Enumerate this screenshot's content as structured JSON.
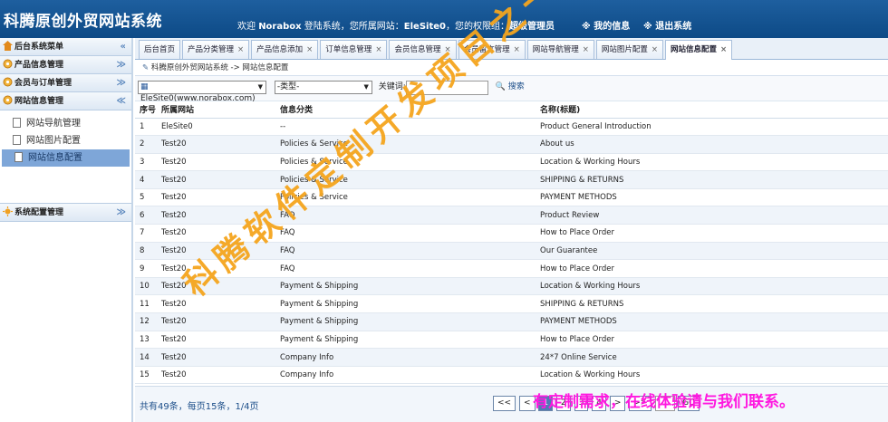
{
  "header": {
    "title": "科腾原创外贸网站系统",
    "welcome_prefix": "欢迎",
    "user": "Norabox",
    "welcome_mid": "登陆系统，您所属网站：",
    "site": "EleSite0",
    "role_prefix": "，您的权限组：",
    "role": "超级管理员",
    "my_info": "※ 我的信息",
    "logout": "※ 退出系统"
  },
  "sidebar": {
    "sections": [
      {
        "label": "后台系统菜单",
        "icon": "house-icon"
      },
      {
        "label": "产品信息管理",
        "icon": "gear-icon"
      },
      {
        "label": "会员与订单管理",
        "icon": "gear-icon"
      },
      {
        "label": "网站信息管理",
        "icon": "gear-icon"
      },
      {
        "label": "系统配置管理",
        "icon": "sun-icon"
      }
    ],
    "items": [
      "网站导航管理",
      "网站图片配置",
      "网站信息配置"
    ],
    "colors": {
      "accent": "#0d4a86",
      "active_item": "#7ea6d8"
    }
  },
  "tabs": [
    {
      "label": "后台首页",
      "closable": false
    },
    {
      "label": "产品分类管理",
      "closable": true
    },
    {
      "label": "产品信息添加",
      "closable": true
    },
    {
      "label": "订单信息管理",
      "closable": true
    },
    {
      "label": "会员信息管理",
      "closable": true
    },
    {
      "label": "会员留言管理",
      "closable": true
    },
    {
      "label": "网站导航管理",
      "closable": true
    },
    {
      "label": "网站图片配置",
      "closable": true
    },
    {
      "label": "网站信息配置",
      "closable": true,
      "active": true
    }
  ],
  "breadcrumb": "科腾原创外贸网站系统 -> 网站信息配置",
  "filters": {
    "site_select": "EleSite0(www.norabox.com)",
    "type_select": "-类型-",
    "keyword_label": "关键词:",
    "keyword_value": "",
    "search_label": "搜索"
  },
  "table": {
    "headers": [
      "序号",
      "所属网站",
      "信息分类",
      "名称(标题)"
    ],
    "rows": [
      [
        "1",
        "EleSite0",
        "--",
        "Product General Introduction"
      ],
      [
        "2",
        "Test20",
        "Policies & Service",
        "About us"
      ],
      [
        "3",
        "Test20",
        "Policies & Service",
        "Location & Working Hours"
      ],
      [
        "4",
        "Test20",
        "Policies & Service",
        "SHIPPING & RETURNS"
      ],
      [
        "5",
        "Test20",
        "Policies & Service",
        "PAYMENT METHODS"
      ],
      [
        "6",
        "Test20",
        "FAQ",
        "Product Review"
      ],
      [
        "7",
        "Test20",
        "FAQ",
        "How to Place Order"
      ],
      [
        "8",
        "Test20",
        "FAQ",
        "Our Guarantee"
      ],
      [
        "9",
        "Test20",
        "FAQ",
        "How to Place Order"
      ],
      [
        "10",
        "Test20",
        "Payment & Shipping",
        "Location & Working Hours"
      ],
      [
        "11",
        "Test20",
        "Payment & Shipping",
        "SHIPPING & RETURNS"
      ],
      [
        "12",
        "Test20",
        "Payment & Shipping",
        "PAYMENT METHODS"
      ],
      [
        "13",
        "Test20",
        "Payment & Shipping",
        "How to Place Order"
      ],
      [
        "14",
        "Test20",
        "Company Info",
        "24*7 Online Service"
      ],
      [
        "15",
        "Test20",
        "Company Info",
        "Location & Working Hours"
      ]
    ]
  },
  "footer": {
    "count_text": "共有49条，每页15条，1/4页",
    "pager": [
      "<<",
      "<",
      "1",
      "2",
      "3",
      "4",
      ">",
      ">>"
    ],
    "go": "GO"
  },
  "watermark": "科腾软件定制开发项目之一",
  "promo": "有定制需求，在线体验请与我们联系。"
}
